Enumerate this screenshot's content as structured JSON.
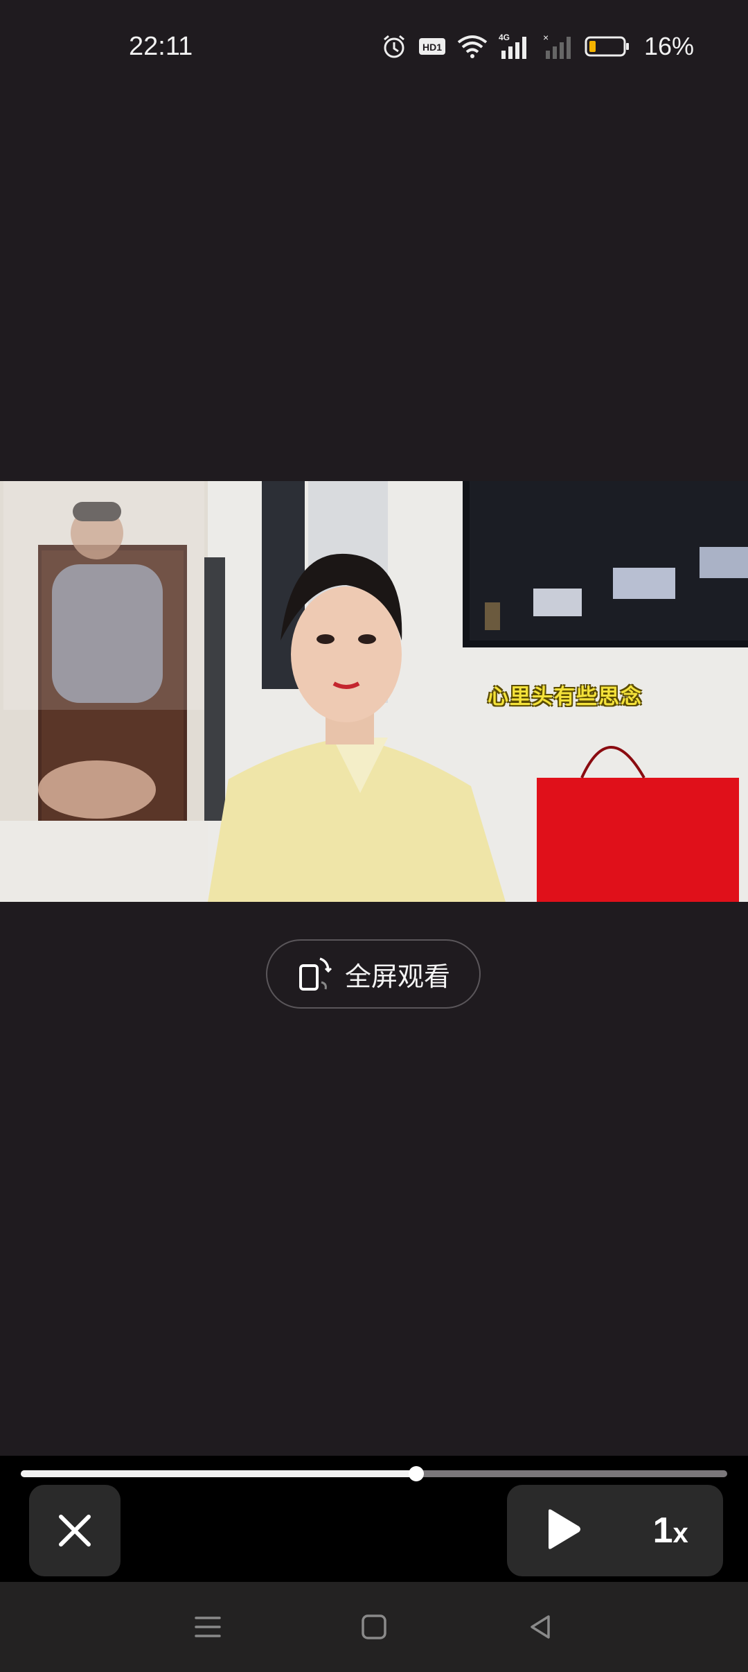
{
  "status_bar": {
    "time": "22:11",
    "battery_percent": "16%",
    "icons": [
      "alarm-icon",
      "hd-icon",
      "wifi-icon",
      "signal-4g-icon",
      "signal-off-icon",
      "battery-icon"
    ],
    "network_badge": "4G",
    "hd_badge": "HD1"
  },
  "video": {
    "subtitle": "心里头有些思念",
    "progress": 0.56
  },
  "fullscreen_button": {
    "label": "全屏观看",
    "icon": "rotate-screen-icon"
  },
  "controls": {
    "close_icon": "close-icon",
    "play_icon": "play-icon",
    "speed_label": "1",
    "speed_suffix": "x"
  },
  "nav_bar": {
    "icons": [
      "menu-icon",
      "home-icon",
      "back-icon"
    ]
  },
  "colors": {
    "background": "#1f1b1f",
    "subtitle": "#f4e23a",
    "control_bg": "#2a2a2a",
    "battery_low": "#f5b400"
  }
}
